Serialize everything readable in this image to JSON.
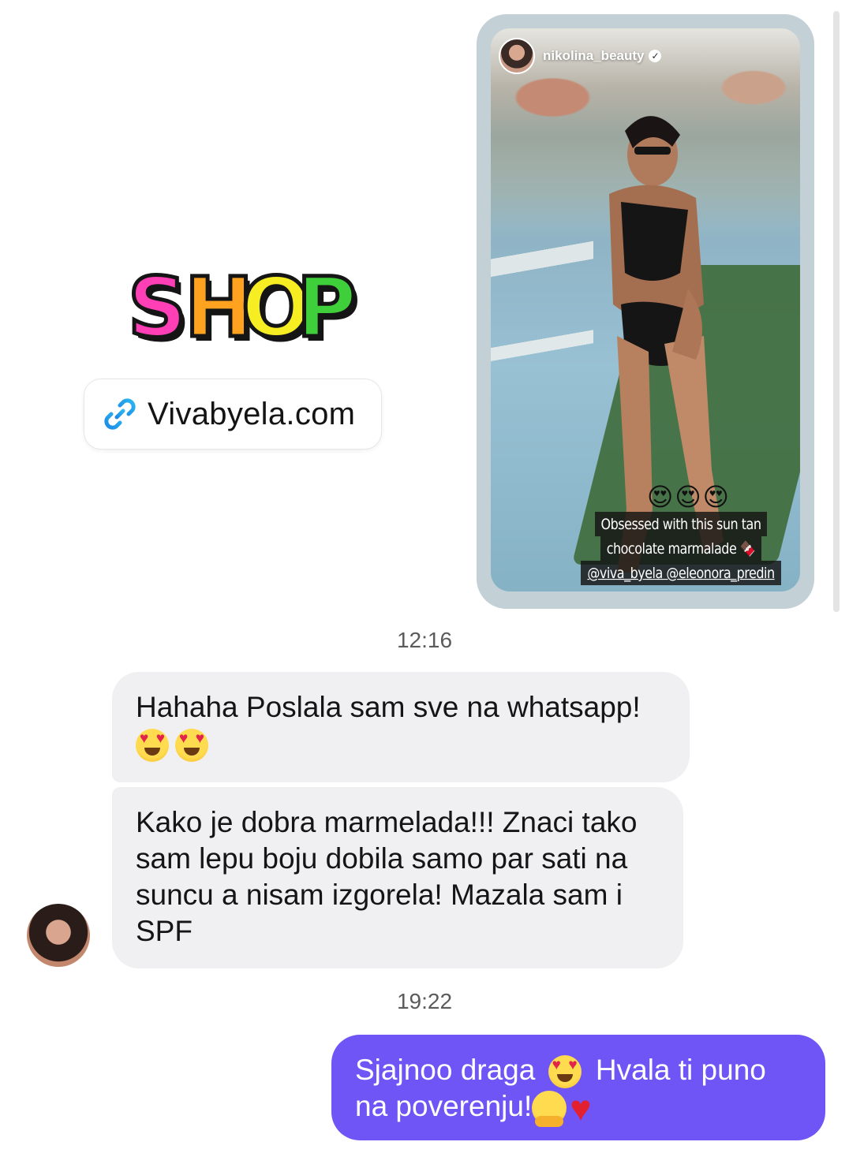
{
  "sticker": {
    "letters": [
      {
        "char": "S",
        "color": "#ff3fb5"
      },
      {
        "char": "H",
        "color": "#ffa21f"
      },
      {
        "char": "O",
        "color": "#f6ee23"
      },
      {
        "char": "P",
        "color": "#3fcf3a"
      }
    ],
    "link_icon": "link-icon",
    "link_text": "Vivabyela.com"
  },
  "story": {
    "username": "nikolina_beauty",
    "verified_icon": "verified-badge-icon",
    "emojis": "😍😍😍",
    "caption_lines": [
      "Obsessed with this sun tan",
      "chocolate marmalade 🍫",
      "@viva_byela @eleonora_predin"
    ]
  },
  "messages": [
    {
      "timestamp": "12:16"
    },
    {
      "text": "Hahaha Poslala sam sve na whatsapp!",
      "emoji_count": 2,
      "emoji": "heart-eyes-emoji"
    },
    {
      "text": "Kako je dobra marmelada!!! Znaci tako sam lepu boju dobila samo par sati na suncu a nisam izgorela! Mazala sam i SPF"
    },
    {
      "timestamp": "19:22"
    },
    {
      "text_before": "Sjajnoo draga",
      "text_middle": "Hvala ti puno na poverenju!",
      "emojis": [
        "heart-eyes-emoji",
        "hugging-face-emoji",
        "red-heart-emoji"
      ]
    }
  ],
  "colors": {
    "sent_bubble": "#6f55f6",
    "received_bubble": "#f0f0f3",
    "timestamp": "#5b5b5b"
  }
}
